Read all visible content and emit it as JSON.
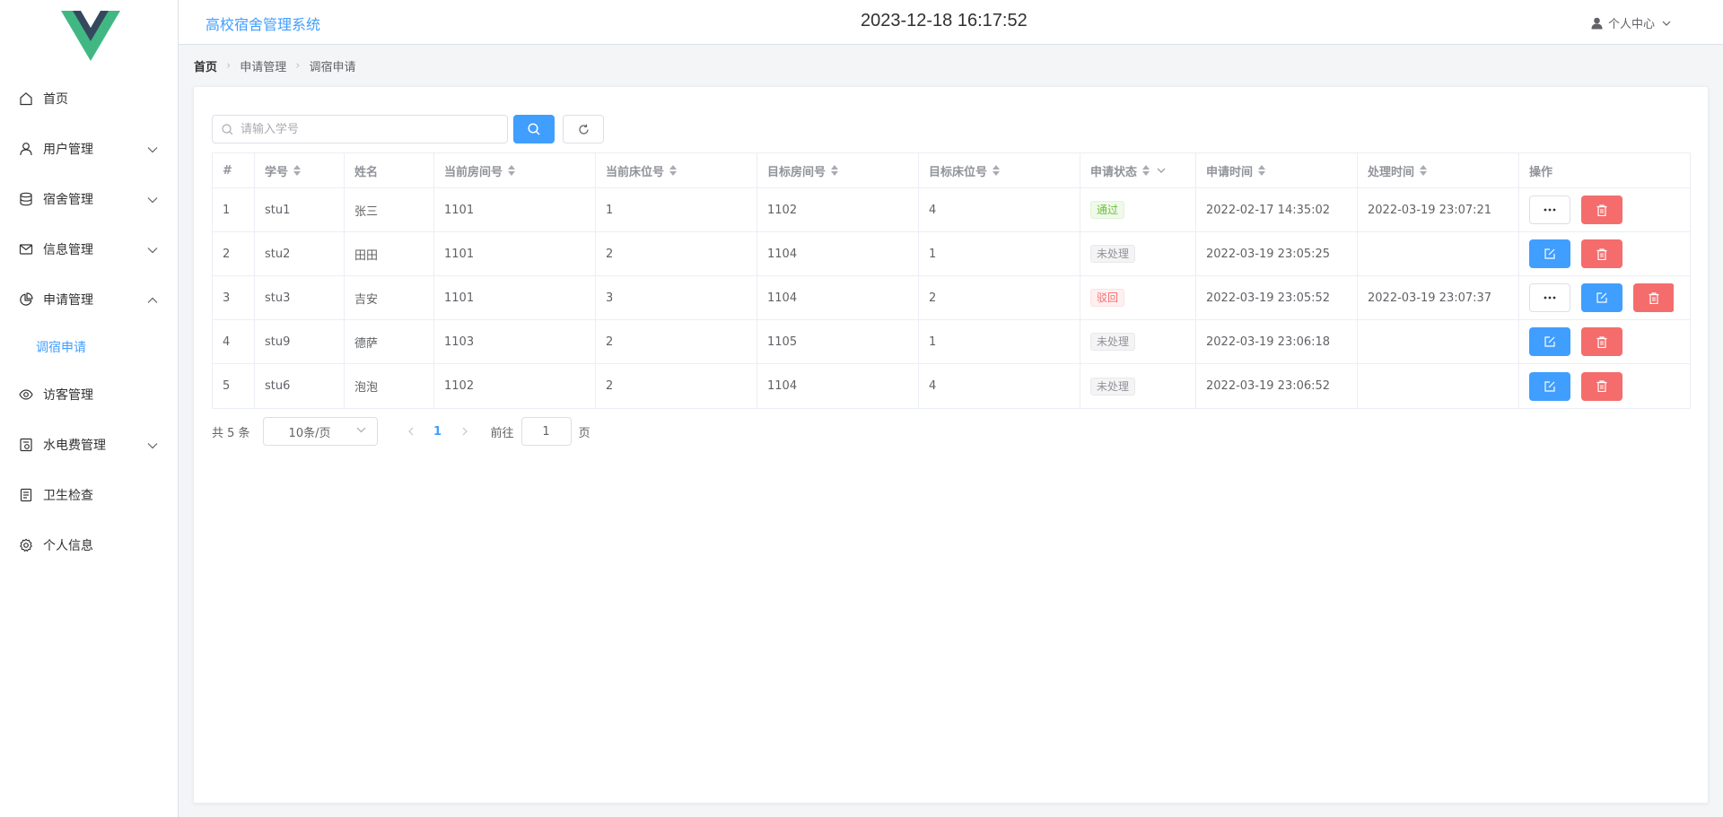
{
  "header": {
    "system_title": "高校宿舍管理系统",
    "datetime": "2023-12-18 16:17:52",
    "user_center": "个人中心"
  },
  "sidebar": {
    "items": [
      {
        "label": "首页",
        "icon": "home-icon",
        "expandable": false
      },
      {
        "label": "用户管理",
        "icon": "user-icon",
        "expandable": true
      },
      {
        "label": "宿舍管理",
        "icon": "database-icon",
        "expandable": true
      },
      {
        "label": "信息管理",
        "icon": "message-icon",
        "expandable": true
      },
      {
        "label": "申请管理",
        "icon": "pie-chart-icon",
        "expandable": true,
        "expanded": true,
        "children": [
          {
            "label": "调宿申请",
            "active": true
          }
        ]
      },
      {
        "label": "访客管理",
        "icon": "eye-icon",
        "expandable": false
      },
      {
        "label": "水电费管理",
        "icon": "bill-icon",
        "expandable": true
      },
      {
        "label": "卫生检查",
        "icon": "document-icon",
        "expandable": false
      },
      {
        "label": "个人信息",
        "icon": "gear-icon",
        "expandable": false
      }
    ]
  },
  "breadcrumb": [
    "首页",
    "申请管理",
    "调宿申请"
  ],
  "search": {
    "placeholder": "请输入学号",
    "value": ""
  },
  "table": {
    "columns": [
      "#",
      "学号",
      "姓名",
      "当前房间号",
      "当前床位号",
      "目标房间号",
      "目标床位号",
      "申请状态",
      "申请时间",
      "处理时间",
      "操作"
    ],
    "rows": [
      {
        "index": "1",
        "student_id": "stu1",
        "name": "张三",
        "cur_room": "1101",
        "cur_bed": "1",
        "target_room": "1102",
        "target_bed": "4",
        "status": "通过",
        "status_type": "pass",
        "apply_time": "2022-02-17 14:35:02",
        "handle_time": "2022-03-19 23:07:21",
        "actions": [
          "more",
          "delete"
        ]
      },
      {
        "index": "2",
        "student_id": "stu2",
        "name": "田田",
        "cur_room": "1101",
        "cur_bed": "2",
        "target_room": "1104",
        "target_bed": "1",
        "status": "未处理",
        "status_type": "pending",
        "apply_time": "2022-03-19 23:05:25",
        "handle_time": "",
        "actions": [
          "edit",
          "delete"
        ]
      },
      {
        "index": "3",
        "student_id": "stu3",
        "name": "吉安",
        "cur_room": "1101",
        "cur_bed": "3",
        "target_room": "1104",
        "target_bed": "2",
        "status": "驳回",
        "status_type": "reject",
        "apply_time": "2022-03-19 23:05:52",
        "handle_time": "2022-03-19 23:07:37",
        "actions": [
          "more",
          "edit",
          "delete"
        ]
      },
      {
        "index": "4",
        "student_id": "stu9",
        "name": "德萨",
        "cur_room": "1103",
        "cur_bed": "2",
        "target_room": "1105",
        "target_bed": "1",
        "status": "未处理",
        "status_type": "pending",
        "apply_time": "2022-03-19 23:06:18",
        "handle_time": "",
        "actions": [
          "edit",
          "delete"
        ]
      },
      {
        "index": "5",
        "student_id": "stu6",
        "name": "泡泡",
        "cur_room": "1102",
        "cur_bed": "2",
        "target_room": "1104",
        "target_bed": "4",
        "status": "未处理",
        "status_type": "pending",
        "apply_time": "2022-03-19 23:06:52",
        "handle_time": "",
        "actions": [
          "edit",
          "delete"
        ]
      }
    ]
  },
  "pagination": {
    "total_text": "共 5 条",
    "page_size": "10条/页",
    "current_page": "1",
    "goto_label": "前往",
    "goto_value": "1",
    "page_suffix": "页"
  },
  "colors": {
    "primary": "#409eff",
    "danger": "#f56c6c",
    "success": "#67c23a",
    "logo_green": "#41b883",
    "logo_dark": "#35495e"
  }
}
